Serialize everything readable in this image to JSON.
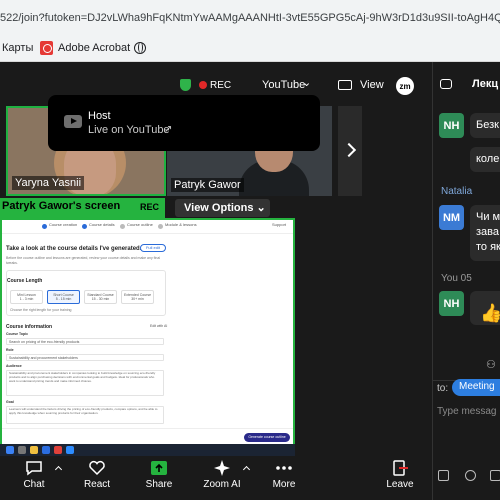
{
  "browser": {
    "url": "522/join?futoken=DJ2vLWha9hFqKNtmYwAAMgAAANHtI-3vtE55GPG5cAj-9hW3rD1d3u9SII-toAgH4Qjrv",
    "bookmarks": [
      "Карты",
      "Adobe Acrobat"
    ]
  },
  "meeting": {
    "rec_label": "REC",
    "youtube_label": "YouTube",
    "view_label": "View",
    "zm_badge": "zm",
    "tooltip": {
      "role": "Host",
      "status": "Live on YouTube"
    },
    "participants": [
      {
        "name": "Yaryna Yasnii",
        "speaking": true
      },
      {
        "name": "Patryk Gawor",
        "speaking": false
      }
    ],
    "share": {
      "label": "Patryk Gawor's screen",
      "rec": "REC",
      "view_options": "View Options"
    }
  },
  "shared_screen": {
    "steps": [
      "Course creation",
      "Course details",
      "Course outline",
      "Module & lessons"
    ],
    "corner_label": "Support",
    "title": "Take a look at the course details I've generated.",
    "full_edit": "Full edit",
    "subtitle": "Before the course outline and lessons are generated, review your course details and make any final tweaks.",
    "course_length": {
      "heading": "Course Length",
      "options": [
        {
          "name": "Mini Lesson",
          "desc": "1 - 3 min",
          "selected": false
        },
        {
          "name": "Short Course",
          "desc": "5 - 15 min",
          "selected": true
        },
        {
          "name": "Standard Course",
          "desc": "15 - 30 min",
          "selected": false
        },
        {
          "name": "Extended Course",
          "desc": "30+ min",
          "selected": false
        }
      ],
      "footer": "Choose the right length for your training"
    },
    "course_info": {
      "heading": "Course information",
      "edit": "Edit with AI",
      "fields": [
        {
          "label": "Course Topic",
          "value": "Search on pricing of the eco-friendly products"
        },
        {
          "label": "Role",
          "value": "Sustainability and procurement stakeholders"
        },
        {
          "label": "Audience",
          "value": "Sustainability and procurement stakeholders in companies looking to build knowledge on sourcing eco-friendly products and to align purchasing decisions with environmental goals and budgets. Ideal for professionals who want to understand pricing trends and make informed choices."
        },
        {
          "label": "Goal",
          "value": "Learners will understand the factors driving the pricing of eco-friendly products, compare options, and be able to apply this knowledge when sourcing products for their organisation."
        }
      ]
    },
    "generate_button": "Generate course outline"
  },
  "controls": [
    {
      "label": "Chat",
      "icon": "chat-icon"
    },
    {
      "label": "React",
      "icon": "heart-icon"
    },
    {
      "label": "Share",
      "icon": "share-icon"
    },
    {
      "label": "Zoom AI",
      "icon": "sparkle-icon"
    },
    {
      "label": "More",
      "icon": "more-icon"
    },
    {
      "label": "Leave",
      "icon": "leave-icon"
    }
  ],
  "chat_panel": {
    "title": "Лекц",
    "messages": [
      {
        "avatar": "NH",
        "text": "Безк"
      },
      {
        "avatar": "",
        "text": "коле"
      },
      {
        "sender": "Natalia",
        "avatar": "NM",
        "text": "Чи м\nзава\nто як"
      },
      {
        "sender": "You 05",
        "avatar": "NH",
        "text": "👍"
      }
    ],
    "to_label": "to:",
    "recipient": "Meeting",
    "placeholder": "Type messag"
  },
  "colors": {
    "active_speaker": "#1fb141",
    "share_green": "#25b33f",
    "rec": "#e02828",
    "avatar_nh": "#2e8b57",
    "avatar_nm": "#3b7bd4",
    "meeting_pill": "#2d7ee0"
  }
}
